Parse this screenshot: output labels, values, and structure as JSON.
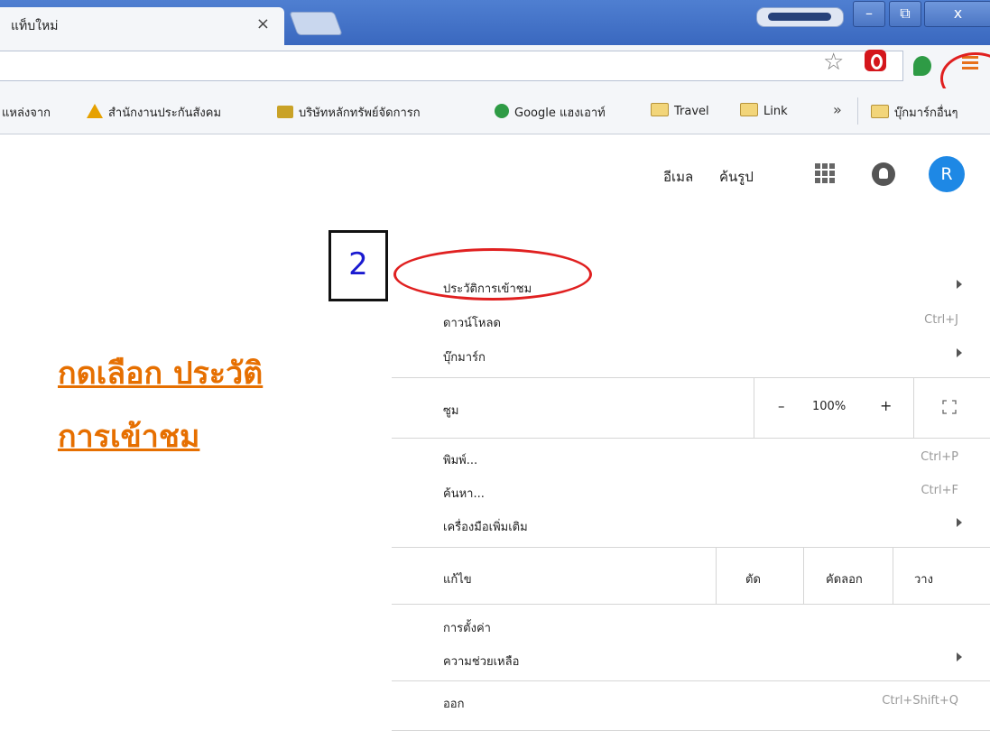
{
  "window": {
    "tab_title": "แท็บใหม่",
    "tab_close": "×",
    "min": "–",
    "max": "⧉",
    "close": "x"
  },
  "bookmarks": [
    {
      "label": "แหล่งจาก",
      "icon": "none"
    },
    {
      "label": "สำนักงานประกันสังคม",
      "icon": "triangle-logo-icon"
    },
    {
      "label": "บริษัทหลักทรัพย์จัดการก",
      "icon": "company-logo-icon"
    },
    {
      "label": "Google แฮงเอาท์",
      "icon": "hangouts-icon"
    },
    {
      "label": "Travel",
      "icon": "folder-icon"
    },
    {
      "label": "Link",
      "icon": "folder-icon"
    },
    {
      "label": "บุ๊กมาร์กอื่นๆ",
      "icon": "folder-icon"
    }
  ],
  "bookmarks_more": "»",
  "google": {
    "email": "อีเมล",
    "images": "ค้นรูป",
    "avatar_letter": "R"
  },
  "annotation": {
    "step_number": "2",
    "instruction_line1": "กดเลือก ประวัติ",
    "instruction_line2": "การเข้าชม",
    "highlight_color": "#e02020",
    "instruction_color": "#e66f00"
  },
  "menu": {
    "history": "ประวัติการเข้าชม",
    "downloads": "ดาวน์โหลด",
    "downloads_shortcut": "Ctrl+J",
    "bookmarks": "บุ๊กมาร์ก",
    "zoom": "ซูม",
    "zoom_minus": "–",
    "zoom_value": "100%",
    "zoom_plus": "+",
    "print": "พิมพ์...",
    "print_shortcut": "Ctrl+P",
    "find": "ค้นหา...",
    "find_shortcut": "Ctrl+F",
    "more_tools": "เครื่องมือเพิ่มเติม",
    "edit": "แก้ไข",
    "cut": "ตัด",
    "copy": "คัดลอก",
    "paste": "วาง",
    "settings": "การตั้งค่า",
    "help": "ความช่วยเหลือ",
    "exit": "ออก",
    "exit_shortcut": "Ctrl+Shift+Q"
  }
}
